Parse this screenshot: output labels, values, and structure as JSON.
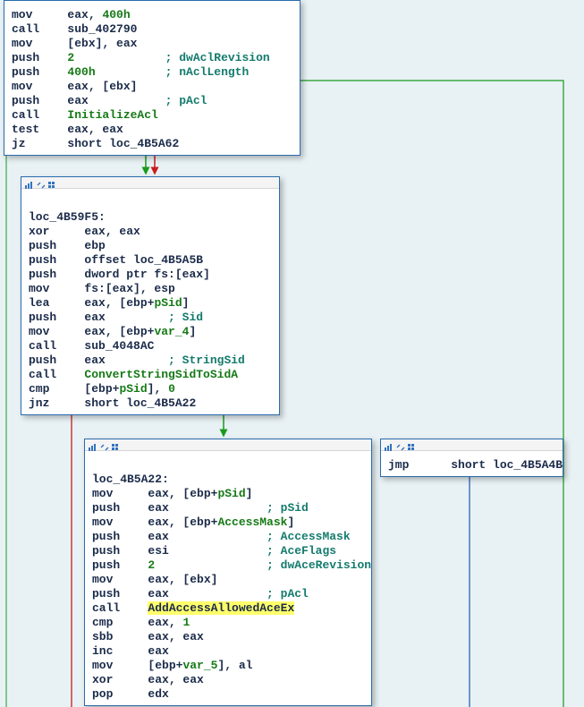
{
  "blocks": {
    "b0": [
      {
        "op": "mov",
        "args": "eax, ",
        "num": "400h"
      },
      {
        "op": "call",
        "args": "sub_402790"
      },
      {
        "op": "mov",
        "args": "[ebx], eax"
      },
      {
        "op": "push",
        "num": "2",
        "cm": "; dwAclRevision"
      },
      {
        "op": "push",
        "num": "400h",
        "cm": "; nAclLength"
      },
      {
        "op": "mov",
        "args": "eax, [ebx]"
      },
      {
        "op": "push",
        "args": "eax",
        "cm": "; pAcl"
      },
      {
        "op": "call",
        "fn": "InitializeAcl"
      },
      {
        "op": "test",
        "args": "eax, eax"
      },
      {
        "op": "jz",
        "args": "short loc_4B5A62"
      }
    ],
    "b1_label": "loc_4B59F5:",
    "b1": [
      {
        "op": "xor",
        "args": "eax, eax"
      },
      {
        "op": "push",
        "args": "ebp"
      },
      {
        "op": "push",
        "args": "offset loc_4B5A5B"
      },
      {
        "op": "push",
        "args": "dword ptr fs:[eax]"
      },
      {
        "op": "mov",
        "args": "fs:[eax], esp"
      },
      {
        "op": "lea",
        "args": "eax, [ebp+",
        "var": "pSid",
        "tail": "]"
      },
      {
        "op": "push",
        "args": "eax",
        "cm": "; Sid"
      },
      {
        "op": "mov",
        "args": "eax, [ebp+",
        "var": "var_4",
        "tail": "]"
      },
      {
        "op": "call",
        "args": "sub_4048AC"
      },
      {
        "op": "push",
        "args": "eax",
        "cm": "; StringSid"
      },
      {
        "op": "call",
        "fn": "ConvertStringSidToSidA"
      },
      {
        "op": "cmp",
        "args": "[ebp+",
        "var": "pSid",
        "tail": "], ",
        "num": "0"
      },
      {
        "op": "jnz",
        "args": "short loc_4B5A22"
      }
    ],
    "b2_label": "loc_4B5A22:",
    "b2": [
      {
        "op": "mov",
        "args": "eax, [ebp+",
        "var": "pSid",
        "tail": "]"
      },
      {
        "op": "push",
        "args": "eax",
        "cm": "; pSid"
      },
      {
        "op": "mov",
        "args": "eax, [ebp+",
        "var": "AccessMask",
        "tail": "]"
      },
      {
        "op": "push",
        "args": "eax",
        "cm": "; AccessMask"
      },
      {
        "op": "push",
        "args": "esi",
        "cm": "; AceFlags"
      },
      {
        "op": "push",
        "num": "2",
        "cm": "; dwAceRevision"
      },
      {
        "op": "mov",
        "args": "eax, [ebx]"
      },
      {
        "op": "push",
        "args": "eax",
        "cm": "; pAcl"
      },
      {
        "op": "call",
        "hl": "AddAccessAllowedAceEx"
      },
      {
        "op": "cmp",
        "args": "eax, ",
        "num": "1"
      },
      {
        "op": "sbb",
        "args": "eax, eax"
      },
      {
        "op": "inc",
        "args": "eax"
      },
      {
        "op": "mov",
        "args": "[ebp+",
        "var": "var_5",
        "tail": "], al"
      },
      {
        "op": "xor",
        "args": "eax, eax"
      },
      {
        "op": "pop",
        "args": "edx"
      }
    ],
    "b3": [
      {
        "op": "jmp",
        "args": "short loc_4B5A4B"
      }
    ]
  },
  "col": {
    "op": 8,
    "cm_b0": 22,
    "cm_b1": 20,
    "cm_b2": 25
  }
}
